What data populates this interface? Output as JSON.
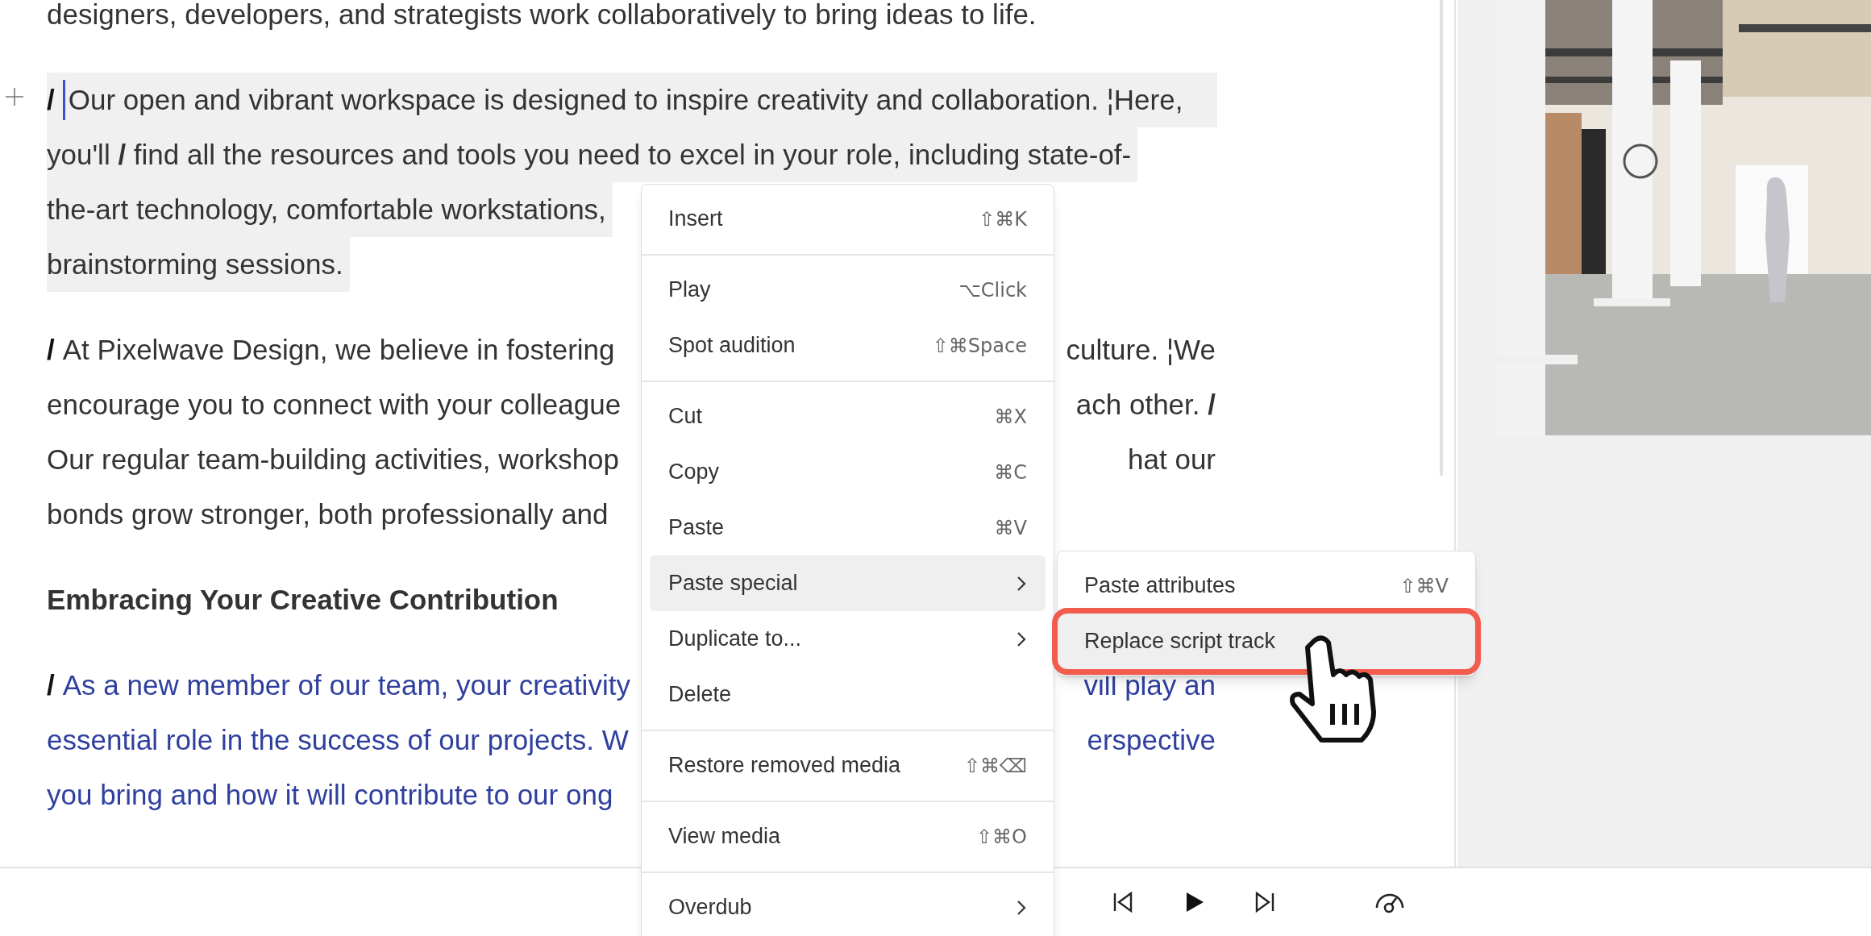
{
  "document": {
    "paragraphs": [
      {
        "kind": "paragraph",
        "highlighted": false,
        "accent": false,
        "caret": false,
        "lines": [
          {
            "text": "designers, developers, and strategists work collaboratively to bring ideas to life."
          }
        ]
      },
      {
        "kind": "paragraph",
        "highlighted": true,
        "accent": false,
        "caret": true,
        "lines": [
          {
            "marker": "/",
            "text": "Our open and vibrant workspace is designed to inspire creativity and collaboration. ¦Here,"
          },
          {
            "text": "you'll **/** find all the resources and tools you need to excel in your role, including state-of-"
          },
          {
            "text": "the-art technology, comfortable workstations,"
          },
          {
            "text": "brainstorming sessions."
          }
        ]
      },
      {
        "kind": "paragraph",
        "highlighted": false,
        "accent": false,
        "caret": false,
        "lines": [
          {
            "marker": "/",
            "text": "At Pixelwave Design, we believe in fostering",
            "right": "culture. ¦We"
          },
          {
            "text": "encourage you to connect with your colleague",
            "right": "ach other. **/**"
          },
          {
            "text": "Our regular team-building activities, workshop",
            "right": "hat our"
          },
          {
            "text": "bonds grow stronger, both professionally and"
          }
        ]
      },
      {
        "kind": "heading",
        "highlighted": false,
        "accent": false,
        "caret": false,
        "lines": [
          {
            "text": "Embracing Your Creative Contribution"
          }
        ]
      },
      {
        "kind": "paragraph",
        "highlighted": false,
        "accent": true,
        "caret": false,
        "lines": [
          {
            "marker": "/",
            "text": "As a new member of our team, your creativity",
            "right": "vill play an"
          },
          {
            "text": "essential role in the success of our projects. W",
            "right": "erspective"
          },
          {
            "text": "you bring and how it will contribute to our ong"
          }
        ]
      }
    ]
  },
  "context_menu": {
    "items": [
      {
        "kind": "item",
        "label": "Insert",
        "shortcut": "⇧⌘K",
        "has_submenu": false,
        "selected": false
      },
      {
        "kind": "separator"
      },
      {
        "kind": "item",
        "label": "Play",
        "shortcut": "⌥Click",
        "has_submenu": false,
        "selected": false
      },
      {
        "kind": "item",
        "label": "Spot audition",
        "shortcut": "⇧⌘Space",
        "has_submenu": false,
        "selected": false
      },
      {
        "kind": "separator"
      },
      {
        "kind": "item",
        "label": "Cut",
        "shortcut": "⌘X",
        "has_submenu": false,
        "selected": false
      },
      {
        "kind": "item",
        "label": "Copy",
        "shortcut": "⌘C",
        "has_submenu": false,
        "selected": false
      },
      {
        "kind": "item",
        "label": "Paste",
        "shortcut": "⌘V",
        "has_submenu": false,
        "selected": false
      },
      {
        "kind": "item",
        "label": "Paste special",
        "has_submenu": true,
        "selected": true
      },
      {
        "kind": "item",
        "label": "Duplicate to...",
        "has_submenu": true,
        "selected": false
      },
      {
        "kind": "item",
        "label": "Delete",
        "has_submenu": false,
        "selected": false
      },
      {
        "kind": "separator"
      },
      {
        "kind": "item",
        "label": "Restore removed media",
        "shortcut": "⇧⌘⌫",
        "has_submenu": false,
        "selected": false
      },
      {
        "kind": "separator"
      },
      {
        "kind": "item",
        "label": "View media",
        "shortcut": "⇧⌘O",
        "has_submenu": false,
        "selected": false
      },
      {
        "kind": "separator"
      },
      {
        "kind": "item",
        "label": "Overdub",
        "has_submenu": true,
        "selected": false
      }
    ]
  },
  "submenu": {
    "items": [
      {
        "label": "Paste attributes",
        "shortcut": "⇧⌘V",
        "selected": false,
        "outlined": false
      },
      {
        "label": "Replace script track",
        "selected": true,
        "outlined": true
      }
    ]
  }
}
